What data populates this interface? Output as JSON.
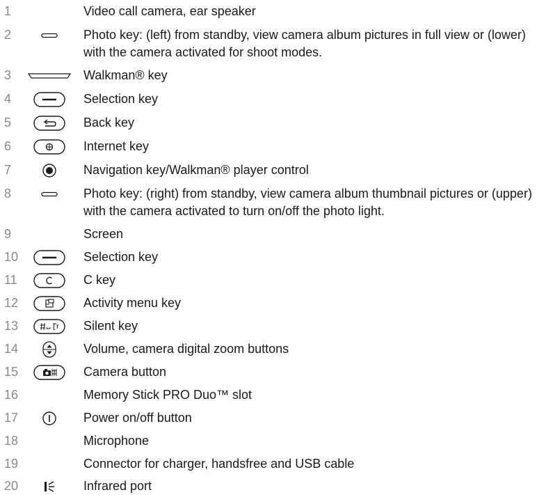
{
  "items": [
    {
      "num": "1",
      "icon": "none",
      "text": "Video call camera, ear speaker"
    },
    {
      "num": "2",
      "icon": "photo-key-icon",
      "text": "Photo key: (left) from standby, view camera album pictures in full view or (lower) with the camera activated for shoot modes."
    },
    {
      "num": "3",
      "icon": "walkman-key-icon",
      "text": "Walkman® key"
    },
    {
      "num": "4",
      "icon": "selection-key-icon",
      "text": "Selection key"
    },
    {
      "num": "5",
      "icon": "back-key-icon",
      "text": "Back key"
    },
    {
      "num": "6",
      "icon": "internet-key-icon",
      "text": "Internet key"
    },
    {
      "num": "7",
      "icon": "navigation-key-icon",
      "text": "Navigation key/Walkman® player control"
    },
    {
      "num": "8",
      "icon": "photo-key-icon",
      "text": "Photo key: (right) from standby, view camera album thumbnail pictures or (upper) with the camera activated to turn on/off the photo light."
    },
    {
      "num": "9",
      "icon": "none",
      "text": "Screen"
    },
    {
      "num": "10",
      "icon": "selection-key-icon",
      "text": "Selection key"
    },
    {
      "num": "11",
      "icon": "c-key-icon",
      "text": "C key"
    },
    {
      "num": "12",
      "icon": "activity-menu-key-icon",
      "text": "Activity menu key"
    },
    {
      "num": "13",
      "icon": "silent-key-icon",
      "text": "Silent key"
    },
    {
      "num": "14",
      "icon": "volume-buttons-icon",
      "text": "Volume, camera digital zoom buttons"
    },
    {
      "num": "15",
      "icon": "camera-button-icon",
      "text": "Camera button"
    },
    {
      "num": "16",
      "icon": "none",
      "text": "Memory Stick PRO Duo™ slot"
    },
    {
      "num": "17",
      "icon": "power-button-icon",
      "text": "Power on/off button"
    },
    {
      "num": "18",
      "icon": "none",
      "text": "Microphone"
    },
    {
      "num": "19",
      "icon": "none",
      "text": "Connector for charger, handsfree and USB cable"
    },
    {
      "num": "20",
      "icon": "infrared-port-icon",
      "text": "Infrared port"
    }
  ]
}
